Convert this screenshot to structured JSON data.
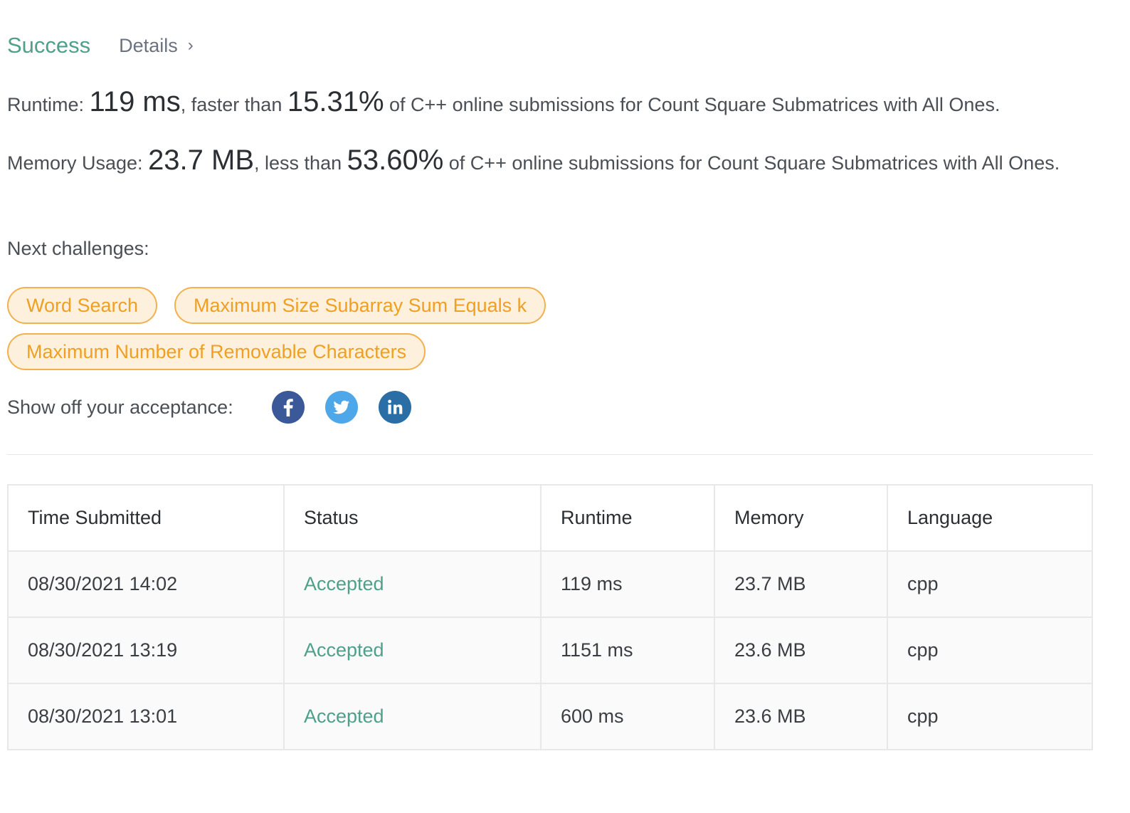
{
  "header": {
    "status": "Success",
    "details_label": "Details",
    "details_chevron": "›"
  },
  "runtime": {
    "label": "Runtime: ",
    "value": "119 ms",
    "comparison": ", faster than ",
    "percent": "15.31%",
    "suffix": " of C++ online submissions for Count Square Submatrices with All Ones."
  },
  "memory": {
    "label": "Memory Usage: ",
    "value": "23.7 MB",
    "comparison": ", less than ",
    "percent": "53.60%",
    "suffix": " of C++ online submissions for Count Square Submatrices with All Ones."
  },
  "next_challenges": {
    "label": "Next challenges:",
    "items": [
      "Word Search",
      "Maximum Size Subarray Sum Equals k",
      "Maximum Number of Removable Characters"
    ]
  },
  "share": {
    "label": "Show off your acceptance:",
    "icons": [
      "facebook-icon",
      "twitter-icon",
      "linkedin-icon"
    ]
  },
  "colors": {
    "success": "#4ea08a",
    "tag_border": "#f2b04e",
    "tag_text": "#ef9f22",
    "tag_bg": "#fdf1dd",
    "facebook": "#3b5998",
    "twitter": "#4da7e8",
    "linkedin": "#2b6ea5"
  },
  "table": {
    "headers": [
      "Time Submitted",
      "Status",
      "Runtime",
      "Memory",
      "Language"
    ],
    "rows": [
      [
        "08/30/2021 14:02",
        "Accepted",
        "119 ms",
        "23.7 MB",
        "cpp"
      ],
      [
        "08/30/2021 13:19",
        "Accepted",
        "1151 ms",
        "23.6 MB",
        "cpp"
      ],
      [
        "08/30/2021 13:01",
        "Accepted",
        "600 ms",
        "23.6 MB",
        "cpp"
      ]
    ]
  }
}
